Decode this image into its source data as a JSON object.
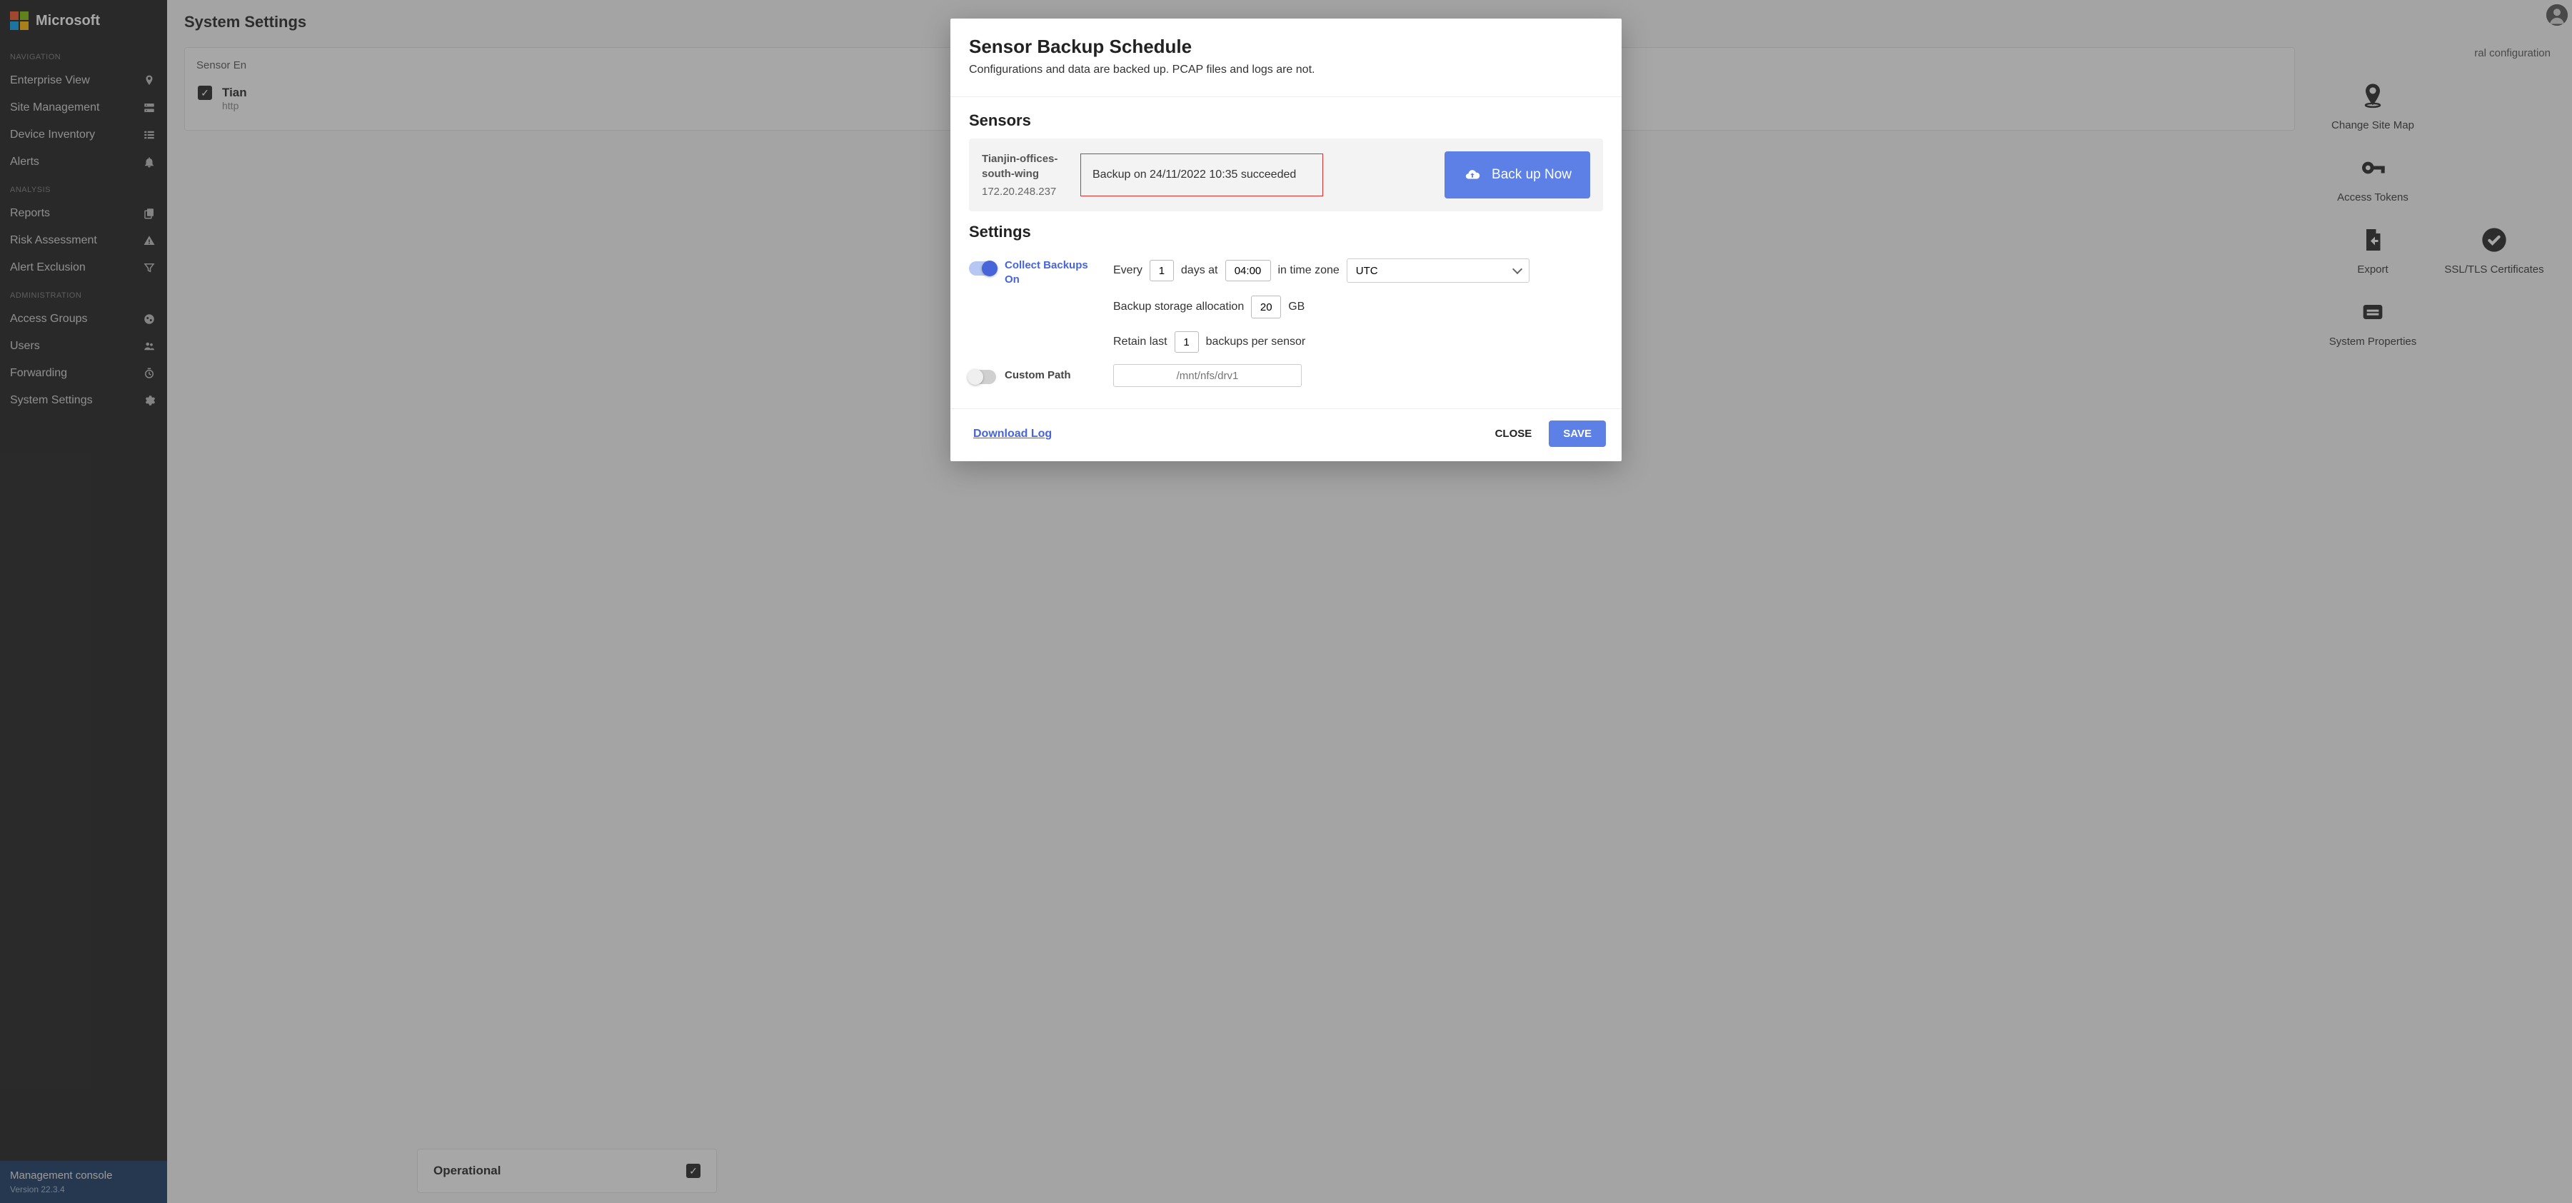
{
  "brand": "Microsoft",
  "page_title": "System Settings",
  "sidebar": {
    "sections": [
      {
        "label": "Navigation",
        "items": [
          {
            "label": "Enterprise View",
            "icon": "map-pin-icon"
          },
          {
            "label": "Site Management",
            "icon": "server-icon"
          },
          {
            "label": "Device Inventory",
            "icon": "list-icon"
          },
          {
            "label": "Alerts",
            "icon": "bell-icon"
          }
        ]
      },
      {
        "label": "Analysis",
        "items": [
          {
            "label": "Reports",
            "icon": "copy-icon"
          },
          {
            "label": "Risk Assessment",
            "icon": "warning-icon"
          },
          {
            "label": "Alert Exclusion",
            "icon": "filter-icon"
          }
        ]
      },
      {
        "label": "Administration",
        "items": [
          {
            "label": "Access Groups",
            "icon": "globe-icon"
          },
          {
            "label": "Users",
            "icon": "people-icon"
          },
          {
            "label": "Forwarding",
            "icon": "clock-icon"
          },
          {
            "label": "System Settings",
            "icon": "gear-icon"
          }
        ]
      }
    ],
    "footer": {
      "title": "Management console",
      "version": "Version 22.3.4"
    }
  },
  "sensor_list": {
    "tab": "Sensor En",
    "row": {
      "name": "Tian",
      "sub": "http"
    }
  },
  "general_panel": {
    "header": "ral configuration",
    "tiles": [
      {
        "label": "Change Site Map"
      },
      {
        "label": "Access Tokens"
      },
      {
        "label": "Export"
      },
      {
        "label": "System Properties"
      },
      {
        "label": "SSL/TLS Certificates"
      }
    ]
  },
  "operational_card": {
    "title": "Operational"
  },
  "modal": {
    "title": "Sensor Backup Schedule",
    "subtitle": "Configurations and data are backed up. PCAP files and logs are not.",
    "sensors_header": "Sensors",
    "sensor": {
      "name": "Tianjin-offices-south-wing",
      "ip": "172.20.248.237",
      "status": "Backup on 24/11/2022 10:35 succeeded"
    },
    "backup_btn": "Back up Now",
    "settings_header": "Settings",
    "collect_toggle": {
      "label": "Collect Backups On"
    },
    "schedule": {
      "every_prefix": "Every",
      "days_value": "1",
      "days_suffix": "days at",
      "time_value": "04:00",
      "tz_prefix": "in time zone",
      "tz_value": "UTC"
    },
    "storage": {
      "prefix": "Backup storage allocation",
      "value": "20",
      "suffix": "GB"
    },
    "retain": {
      "prefix": "Retain last",
      "value": "1",
      "suffix": "backups per sensor"
    },
    "custom_path": {
      "label": "Custom Path",
      "placeholder": "/mnt/nfs/drv1"
    },
    "download_log": "Download Log",
    "close": "CLOSE",
    "save": "SAVE"
  }
}
